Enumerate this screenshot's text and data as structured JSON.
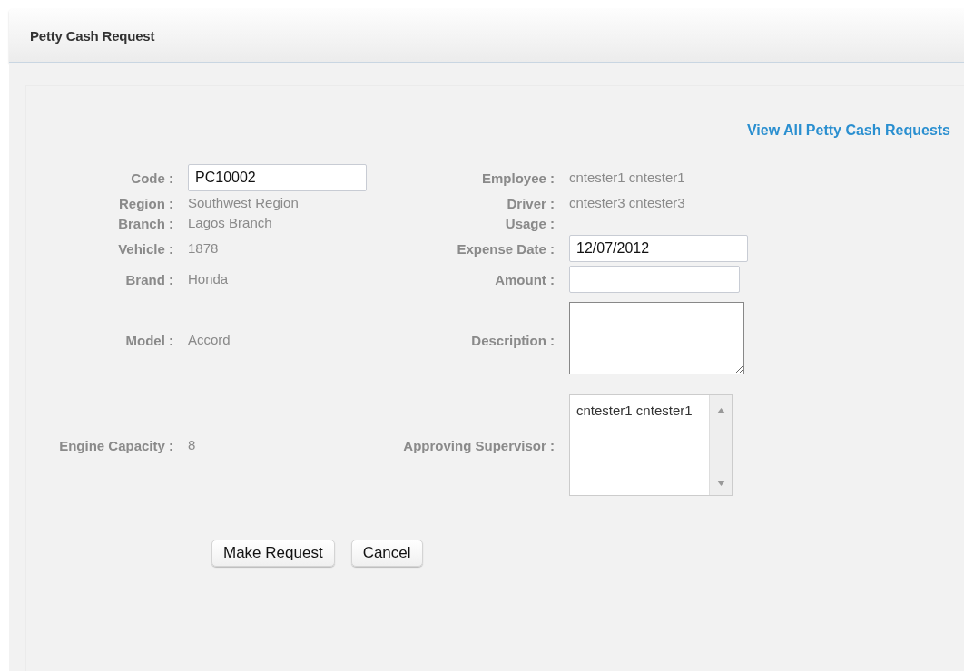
{
  "window": {
    "title": "Petty Cash Request"
  },
  "link": "View All Petty Cash Requests",
  "rows": [
    {
      "left": {
        "kind": "input",
        "label": "Code :",
        "value": "PC10002"
      },
      "right": {
        "kind": "text",
        "label": "Employee :",
        "value": "cntester1 cntester1"
      }
    },
    {
      "left": {
        "kind": "text",
        "label": "Region :",
        "value": "Southwest Region"
      },
      "right": {
        "kind": "text",
        "label": "Driver :",
        "value": "cntester3 cntester3"
      }
    },
    {
      "left": {
        "kind": "text",
        "label": "Branch :",
        "value": "Lagos Branch"
      },
      "right": {
        "kind": "label",
        "label": "Usage :"
      }
    },
    {
      "left": {
        "kind": "text",
        "label": "Vehicle :",
        "value": "1878"
      },
      "right": {
        "kind": "input",
        "label": "Expense Date :",
        "value": "12/07/2012"
      }
    },
    {
      "left": {
        "kind": "text",
        "label": "Brand :",
        "value": "Honda"
      },
      "right": {
        "kind": "input",
        "label": "Amount :"
      }
    },
    {
      "left": {
        "kind": "text",
        "label": "Model :",
        "value": "Accord"
      },
      "right": {
        "kind": "textarea",
        "label": "Description :"
      }
    },
    {
      "left": {
        "kind": "text",
        "label": "Engine Capacity :",
        "value": "8"
      },
      "right": {
        "kind": "listbox",
        "label": "Approving Supervisor :",
        "options": [
          "cntester1 cntester1"
        ]
      }
    }
  ],
  "buttons": [
    "Make Request",
    "Cancel"
  ]
}
